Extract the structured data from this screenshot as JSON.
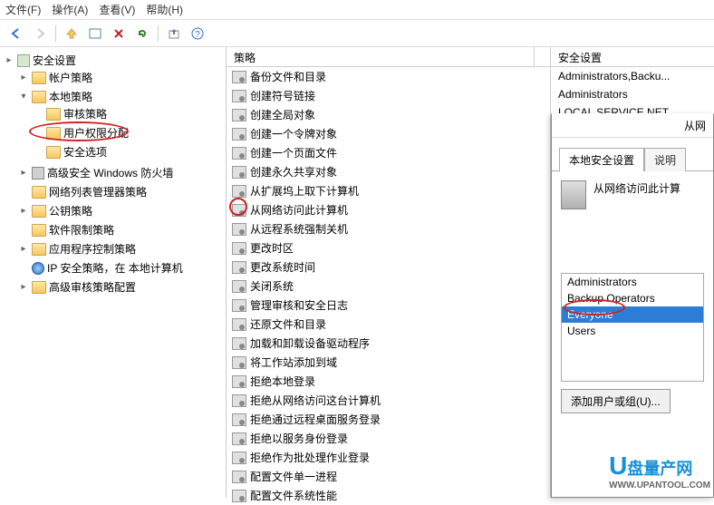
{
  "menu": {
    "file": "文件(F)",
    "action": "操作(A)",
    "view": "查看(V)",
    "help": "帮助(H)"
  },
  "toolbar_icons": {
    "back": "back-icon",
    "forward": "forward-icon",
    "up": "up-icon",
    "props": "props-icon",
    "delete": "delete-icon",
    "refresh": "refresh-icon",
    "export": "export-icon",
    "help": "help-icon"
  },
  "tree": {
    "root": "安全设置",
    "account": "帐户策略",
    "local": "本地策略",
    "audit": "审核策略",
    "user_rights": "用户权限分配",
    "security_opts": "安全选项",
    "firewall": "高级安全 Windows 防火墙",
    "netlist": "网络列表管理器策略",
    "pubkey": "公钥策略",
    "software": "软件限制策略",
    "appctrl": "应用程序控制策略",
    "ipsec": "IP 安全策略，在 本地计算机",
    "audit_cfg": "高级审核策略配置"
  },
  "center_header": {
    "policy": "策略",
    "setting": "安全设置"
  },
  "policies": [
    "备份文件和目录",
    "创建符号链接",
    "创建全局对象",
    "创建一个令牌对象",
    "创建一个页面文件",
    "创建永久共享对象",
    "从扩展坞上取下计算机",
    "从网络访问此计算机",
    "从远程系统强制关机",
    "更改时区",
    "更改系统时间",
    "关闭系统",
    "管理审核和安全日志",
    "还原文件和目录",
    "加载和卸载设备驱动程序",
    "将工作站添加到域",
    "拒绝本地登录",
    "拒绝从网络访问这台计算机",
    "拒绝通过远程桌面服务登录",
    "拒绝以服务身份登录",
    "拒绝作为批处理作业登录",
    "配置文件单一进程",
    "配置文件系统性能"
  ],
  "settings": [
    "Administrators,Backu...",
    "Administrators",
    "LOCAL SERVICE,NET..."
  ],
  "dialog": {
    "title_suffix": "从网",
    "tab_local": "本地安全设置",
    "tab_explain": "说明",
    "heading": "从网络访问此计算",
    "groups": [
      "Administrators",
      "Backup Operators",
      "Everyone",
      "Users"
    ],
    "selected": "Everyone",
    "add_btn": "添加用户或组(U)..."
  },
  "watermark": {
    "brand": "盘量产网",
    "url": "WWW.UPANTOOL.COM"
  }
}
